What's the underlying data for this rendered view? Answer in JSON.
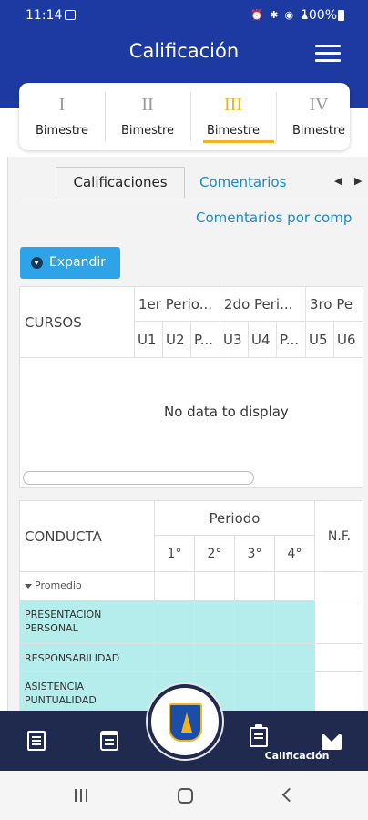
{
  "status_bar": {
    "time": "11:14",
    "battery": "100%"
  },
  "app_bar": {
    "title": "Calificación"
  },
  "bimestres": [
    {
      "roman": "I",
      "label": "Bimestre",
      "active": false
    },
    {
      "roman": "II",
      "label": "Bimestre",
      "active": false
    },
    {
      "roman": "III",
      "label": "Bimestre",
      "active": true
    },
    {
      "roman": "IV",
      "label": "Bimestre",
      "active": false
    }
  ],
  "subtabs": {
    "calificaciones": "Calificaciones",
    "comentarios": "Comentarios",
    "comentarios_por_comp": "Comentarios por comp"
  },
  "expand_button": {
    "label": "Expandir"
  },
  "grades_grid": {
    "first_column": "CURSOS",
    "periods": [
      "1er Perio...",
      "2do Peri...",
      "3ro Pe"
    ],
    "units": [
      "U1",
      "U2",
      "P...",
      "U3",
      "U4",
      "P...",
      "U5",
      "U6"
    ],
    "empty_text": "No data to display"
  },
  "conduct_grid": {
    "first_column": "CONDUCTA",
    "period_header": "Periodo",
    "period_numbers": [
      "1°",
      "2°",
      "3°",
      "4°"
    ],
    "nf_header": "N.F.",
    "group_label": "Promedio",
    "rows": [
      "PRESENTACION PERSONAL",
      "RESPONSABILIDAD",
      "ASISTENCIA PUNTUALIDAD"
    ]
  },
  "bottom_nav": {
    "items": [
      {
        "icon": "document-icon",
        "label": ""
      },
      {
        "icon": "calendar-icon",
        "label": ""
      },
      {
        "icon": "school-logo",
        "label": ""
      },
      {
        "icon": "clipboard-icon",
        "label": "Calificación"
      },
      {
        "icon": "mail-icon",
        "label": ""
      }
    ]
  },
  "colors": {
    "header": "#1d3aa3",
    "accent": "#f2b21b",
    "link": "#1b8ac7",
    "button": "#2fa3e8",
    "teal_row": "#b5edec",
    "bottom_nav": "#1f2a4e"
  }
}
